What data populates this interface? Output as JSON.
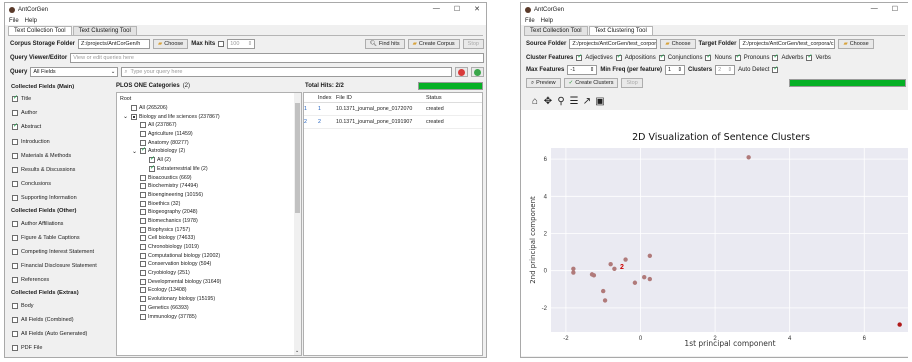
{
  "left": {
    "title": "AntCorGen",
    "menu": [
      "File",
      "Help"
    ],
    "tabs": [
      "Text Collection Tool",
      "Text Clustering Tool"
    ],
    "corpus_folder_label": "Corpus Storage Folder",
    "corpus_folder_value": "Z:/projects/AntCorGen/h",
    "choose_label": "Choose",
    "max_hits_label": "Max hits",
    "max_hits_value": "100",
    "find_hits_label": "Find hits",
    "create_corpus_label": "Create Corpus",
    "stop_label": "Stop",
    "query_viewer_label": "Query Viewer/Editor",
    "query_viewer_placeholder": "View or edit queries here",
    "query_label": "Query",
    "query_select": "All Fields",
    "query_placeholder": "Type your query here",
    "collected_main_label": "Collected Fields (Main)",
    "main_fields": [
      {
        "label": "Title",
        "checked": true
      },
      {
        "label": "Author",
        "checked": false
      },
      {
        "label": "Abstract",
        "checked": true
      },
      {
        "label": "Introduction",
        "checked": false
      },
      {
        "label": "Materials & Methods",
        "checked": false
      },
      {
        "label": "Results & Discussions",
        "checked": false
      },
      {
        "label": "Conclusions",
        "checked": false
      },
      {
        "label": "Supporting Information",
        "checked": false
      }
    ],
    "collected_other_label": "Collected Fields (Other)",
    "other_fields": [
      {
        "label": "Author Affiliations",
        "checked": false
      },
      {
        "label": "Figure & Table Captions",
        "checked": false
      },
      {
        "label": "Competing Interest Statement",
        "checked": false
      },
      {
        "label": "Financial Disclosure Statement",
        "checked": false
      },
      {
        "label": "References",
        "checked": false
      }
    ],
    "collected_extras_label": "Collected Fields (Extras)",
    "extras_fields": [
      {
        "label": "Body",
        "checked": false
      },
      {
        "label": "All Fields (Combined)",
        "checked": false
      },
      {
        "label": "All Fields (Auto Generated)",
        "checked": false
      },
      {
        "label": "PDF File",
        "checked": false
      }
    ],
    "categories_label": "PLOS ONE Categories",
    "categories_count": "(2)",
    "tree_root": "Root",
    "tree_items": [
      {
        "label": "All (265206)",
        "indent": 1,
        "checked": false,
        "arrow": ""
      },
      {
        "label": "Biology and life sciences (237867)",
        "indent": 1,
        "checked": false,
        "arrow": "⌄",
        "partial": true
      },
      {
        "label": "All (237867)",
        "indent": 2,
        "checked": false,
        "arrow": ""
      },
      {
        "label": "Agriculture (11459)",
        "indent": 2,
        "checked": false,
        "arrow": ""
      },
      {
        "label": "Anatomy (80277)",
        "indent": 2,
        "checked": false,
        "arrow": ""
      },
      {
        "label": "Astrobiology (2)",
        "indent": 2,
        "checked": true,
        "arrow": "⌄"
      },
      {
        "label": "All (2)",
        "indent": 3,
        "checked": true,
        "arrow": ""
      },
      {
        "label": "Extraterrestrial life (2)",
        "indent": 3,
        "checked": true,
        "arrow": ""
      },
      {
        "label": "Bioacoustics (669)",
        "indent": 2,
        "checked": false,
        "arrow": ""
      },
      {
        "label": "Biochemistry (74494)",
        "indent": 2,
        "checked": false,
        "arrow": ""
      },
      {
        "label": "Bioengineering (10156)",
        "indent": 2,
        "checked": false,
        "arrow": ""
      },
      {
        "label": "Bioethics (32)",
        "indent": 2,
        "checked": false,
        "arrow": ""
      },
      {
        "label": "Biogeography (2048)",
        "indent": 2,
        "checked": false,
        "arrow": ""
      },
      {
        "label": "Biomechanics (1978)",
        "indent": 2,
        "checked": false,
        "arrow": ""
      },
      {
        "label": "Biophysics (1757)",
        "indent": 2,
        "checked": false,
        "arrow": ""
      },
      {
        "label": "Cell biology (74633)",
        "indent": 2,
        "checked": false,
        "arrow": ""
      },
      {
        "label": "Chronobiology (1019)",
        "indent": 2,
        "checked": false,
        "arrow": ""
      },
      {
        "label": "Computational biology (12002)",
        "indent": 2,
        "checked": false,
        "arrow": ""
      },
      {
        "label": "Conservation biology (594)",
        "indent": 2,
        "checked": false,
        "arrow": ""
      },
      {
        "label": "Cryobiology (251)",
        "indent": 2,
        "checked": false,
        "arrow": ""
      },
      {
        "label": "Developmental biology (31649)",
        "indent": 2,
        "checked": false,
        "arrow": ""
      },
      {
        "label": "Ecology (13408)",
        "indent": 2,
        "checked": false,
        "arrow": ""
      },
      {
        "label": "Evolutionary biology (15195)",
        "indent": 2,
        "checked": false,
        "arrow": ""
      },
      {
        "label": "Genetics (66393)",
        "indent": 2,
        "checked": false,
        "arrow": ""
      },
      {
        "label": "Immunology (37785)",
        "indent": 2,
        "checked": false,
        "arrow": ""
      }
    ],
    "total_hits_label": "Total Hits: 2/2",
    "table_headers": [
      "Index",
      "File ID",
      "Status"
    ],
    "table_rows": [
      {
        "row": "1",
        "index": "1",
        "file_id": "10.1371_journal_pone_0172070",
        "status": "created"
      },
      {
        "row": "2",
        "index": "2",
        "file_id": "10.1371_journal_pone_0191907",
        "status": "created"
      }
    ]
  },
  "right": {
    "title": "AntCorGen",
    "menu": [
      "File",
      "Help"
    ],
    "tabs": [
      "Text Collection Tool",
      "Text Clustering Tool"
    ],
    "source_label": "Source Folder",
    "source_value": "Z:/projects/AntCorGen/test_corpora/c",
    "target_label": "Target Folder",
    "target_value": "Z:/projects/AntCorGen/test_corpora/c",
    "choose_label": "Choose",
    "cluster_features_label": "Cluster Features",
    "features": [
      {
        "label": "Adjectives",
        "checked": true
      },
      {
        "label": "Adpositions",
        "checked": true
      },
      {
        "label": "Conjunctions",
        "checked": true
      },
      {
        "label": "Nouns",
        "checked": true
      },
      {
        "label": "Pronouns",
        "checked": true
      },
      {
        "label": "Adverbs",
        "checked": true
      },
      {
        "label": "Verbs",
        "checked": true
      }
    ],
    "max_features_label": "Max Features",
    "max_features_value": "-1",
    "min_freq_label": "Min Freq (per feature)",
    "min_freq_value": "1",
    "clusters_label": "Clusters",
    "clusters_value": "2",
    "auto_detect_label": "Auto Detect",
    "preview_label": "Preview",
    "create_clusters_label": "Create Clusters",
    "stop_label": "Stop",
    "toolbar_icons": [
      "home-icon",
      "pan-icon",
      "zoom-icon",
      "configure-icon",
      "edit-axis-icon",
      "save-icon"
    ]
  },
  "chart_data": {
    "type": "scatter",
    "title": "2D Visualization of Sentence Clusters",
    "xlabel": "1st principal component",
    "ylabel": "2nd principal component",
    "xlim": [
      -2.4,
      7.2
    ],
    "ylim": [
      -3.3,
      6.6
    ],
    "xticks": [
      -2,
      0,
      2,
      4,
      6
    ],
    "yticks": [
      -2,
      0,
      2,
      4,
      6
    ],
    "series": [
      {
        "color": "#b07a7a",
        "points": [
          [
            -1.8,
            0.1
          ],
          [
            -1.8,
            -0.1
          ],
          [
            -1.3,
            -0.2
          ],
          [
            -1.25,
            -0.25
          ],
          [
            -1.0,
            -1.1
          ],
          [
            -0.95,
            -1.6
          ],
          [
            -0.8,
            0.35
          ],
          [
            -0.7,
            0.1
          ],
          [
            -0.4,
            0.6
          ],
          [
            -0.15,
            -0.65
          ],
          [
            0.1,
            -0.35
          ],
          [
            0.25,
            -0.45
          ],
          [
            0.25,
            0.8
          ],
          [
            2.9,
            6.1
          ]
        ]
      },
      {
        "color": "#b01a1a",
        "points": [
          [
            6.95,
            -2.9
          ]
        ]
      }
    ],
    "annotations": [
      {
        "text": "2",
        "x": -0.55,
        "y": 0.25,
        "color": "#cc0000"
      }
    ]
  }
}
